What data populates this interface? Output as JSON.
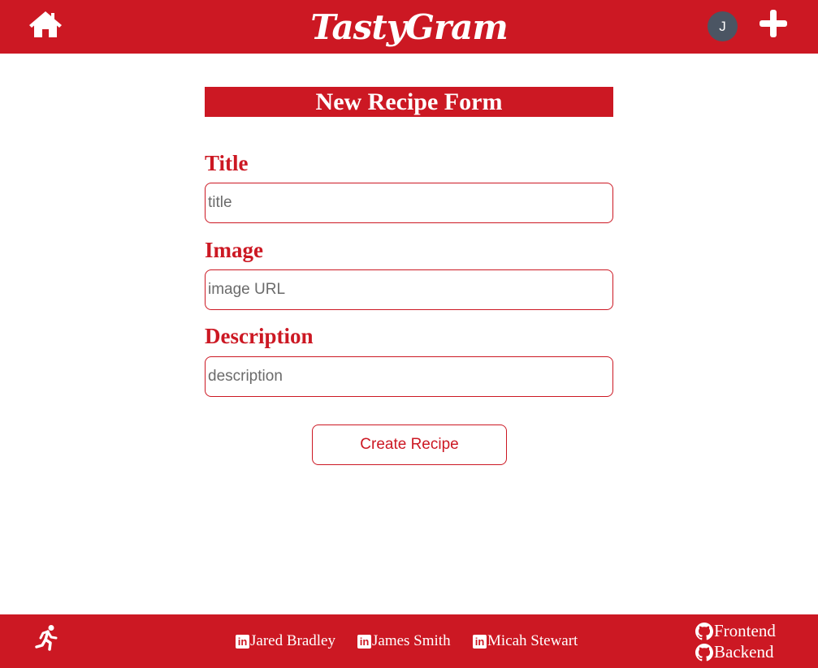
{
  "header": {
    "brand": "TastyGram",
    "avatar_initial": "J",
    "home_icon": "home-icon",
    "add_icon": "plus-icon"
  },
  "form": {
    "heading": "New Recipe Form",
    "fields": [
      {
        "label": "Title",
        "placeholder": "title",
        "value": ""
      },
      {
        "label": "Image",
        "placeholder": "image URL",
        "value": ""
      },
      {
        "label": "Description",
        "placeholder": "description",
        "value": ""
      }
    ],
    "submit_label": "Create Recipe"
  },
  "footer": {
    "runner_icon": "running-person-icon",
    "credits": [
      {
        "icon": "linkedin-icon",
        "name": "Jared Bradley"
      },
      {
        "icon": "linkedin-icon",
        "name": "James Smith"
      },
      {
        "icon": "linkedin-icon",
        "name": "Micah Stewart"
      }
    ],
    "repos": [
      {
        "icon": "github-icon",
        "label": "Frontend"
      },
      {
        "icon": "github-icon",
        "label": "Backend"
      }
    ]
  },
  "colors": {
    "brand_red": "#cc1823",
    "avatar_bg": "#4b5563",
    "background": "#ffffff"
  }
}
